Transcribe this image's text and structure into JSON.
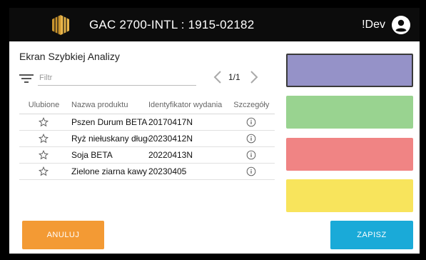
{
  "header": {
    "title": "GAC 2700-INTL : 1915-02182",
    "user": "!Dev",
    "logo_icon": "gac-logo-icon",
    "user_icon": "account-circle-icon",
    "background": "#0c0c0c"
  },
  "screen": {
    "title": "Ekran Szybkiej Analizy"
  },
  "filter": {
    "placeholder": "Filtr",
    "value": "",
    "icon": "filter-list-icon"
  },
  "pager": {
    "text": "1/1"
  },
  "table": {
    "headers": {
      "favorite": "Ulubione",
      "product": "Nazwa produktu",
      "release_id": "Identyfikator wydania",
      "details": "Szczegóły"
    },
    "rows": [
      {
        "product": "Pszen Durum BETA",
        "release_id": "20170417N"
      },
      {
        "product": "Ryż niełuskany długoziarnisty BETA",
        "release_id": "20230412N"
      },
      {
        "product": "Soja BETA",
        "release_id": "20220413N"
      },
      {
        "product": "Zielone ziarna kawy BETA",
        "release_id": "20230405"
      }
    ]
  },
  "swatches": {
    "selected": "#9592c8",
    "colors": [
      "#9592c8",
      "#99d390",
      "#f08484",
      "#f8e45c"
    ]
  },
  "buttons": {
    "cancel": "ANULUJ",
    "save": "ZAPISZ"
  },
  "colors": {
    "cancel": "#f39a34",
    "save": "#1aaad8"
  }
}
